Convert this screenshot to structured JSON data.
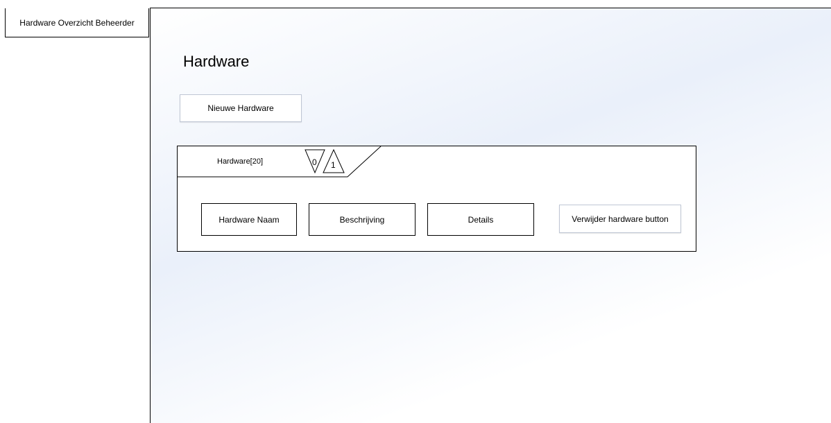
{
  "frame": {
    "title": "Hardware Overzicht Beheerder"
  },
  "page": {
    "heading": "Hardware"
  },
  "toolbar": {
    "new_label": "Nieuwe Hardware"
  },
  "panel": {
    "tab_label": "Hardware[20]",
    "pager": {
      "down_value": "0",
      "up_value": "1"
    },
    "fields": {
      "name": "Hardware Naam",
      "description": "Beschrijving",
      "details": "Details"
    },
    "delete_label": "Verwijder hardware button"
  }
}
